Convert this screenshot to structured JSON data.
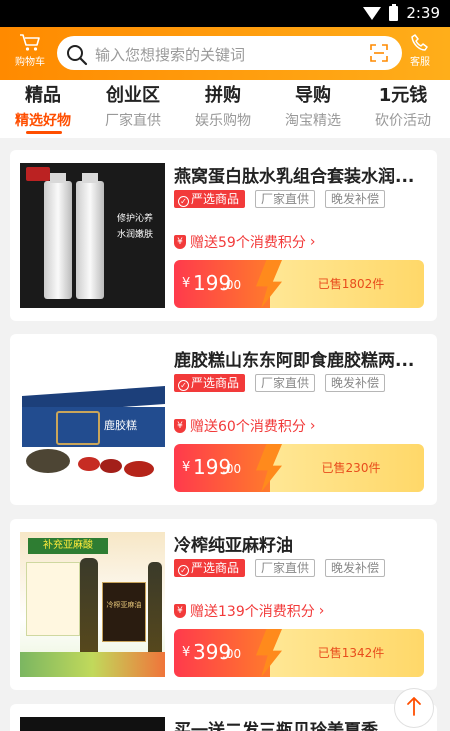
{
  "status_bar": {
    "time": "2:39"
  },
  "header": {
    "cart_label": "购物车",
    "search_placeholder": "输入您想搜索的关键词",
    "service_label": "客服"
  },
  "tabs": [
    {
      "title": "精品",
      "subtitle": "精选好物"
    },
    {
      "title": "创业区",
      "subtitle": "厂家直供"
    },
    {
      "title": "拼购",
      "subtitle": "娱乐购物"
    },
    {
      "title": "导购",
      "subtitle": "淘宝精选"
    },
    {
      "title": "1元钱",
      "subtitle": "砍价活动"
    }
  ],
  "products": [
    {
      "title": "燕窝蛋白肽水乳组合套装水润...",
      "tags": [
        "严选商品",
        "厂家直供",
        "晚发补偿"
      ],
      "points": "赠送59个消费积分",
      "currency": "¥",
      "price_int": "199",
      "price_dec": ".00",
      "sold": "已售1802件",
      "image_text": [
        "修护沁养",
        "水润嫩肤"
      ]
    },
    {
      "title": "鹿胶糕山东东阿即食鹿胶糕两...",
      "tags": [
        "严选商品",
        "厂家直供",
        "晚发补偿"
      ],
      "points": "赠送60个消费积分",
      "currency": "¥",
      "price_int": "199",
      "price_dec": ".00",
      "sold": "已售230件",
      "image_text": [
        "鹿胶糕"
      ]
    },
    {
      "title": "冷榨纯亚麻籽油",
      "tags": [
        "严选商品",
        "厂家直供",
        "晚发补偿"
      ],
      "points": "赠送139个消费积分",
      "currency": "¥",
      "price_int": "399",
      "price_dec": ".00",
      "sold": "已售1342件",
      "image_text": [
        "补充亚麻酸",
        "冷榨亚麻油"
      ]
    },
    {
      "title": "买一送二发三瓶贝玲美夏季遮..."
    }
  ],
  "colors": {
    "accent": "#ff8a00",
    "red": "#f23a3a",
    "tab_active": "#ff4e00"
  }
}
